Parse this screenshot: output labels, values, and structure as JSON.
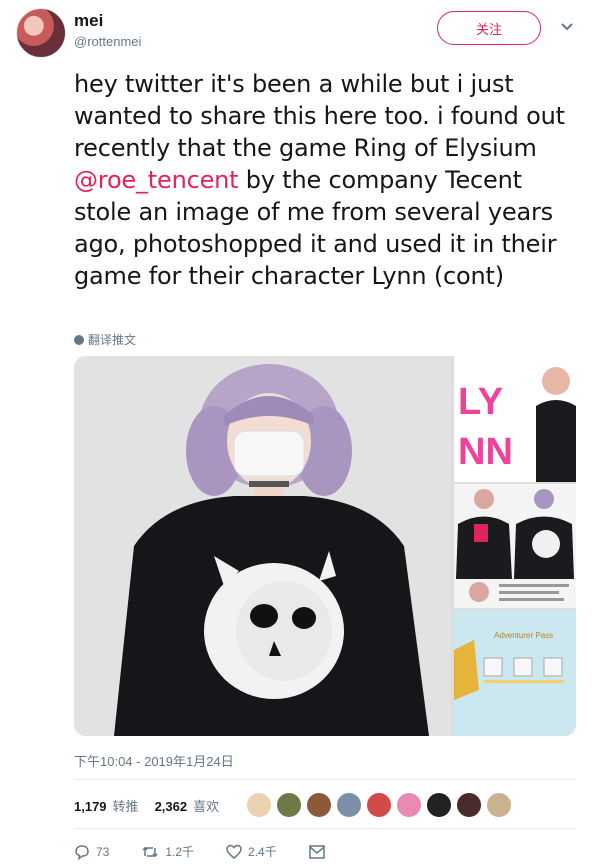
{
  "author": {
    "name": "mei",
    "handle": "@rottenmei"
  },
  "follow_label": "关注",
  "tweet": {
    "text_before": "hey twitter it's been a while but i just wanted to share this here too. i found out recently that the game Ring of Elysium ",
    "mention": "@roe_tencent",
    "text_after": " by the company Tecent stole an image of me from several years ago, photoshopped it and used it in their game for their character Lynn (cont)",
    "translate_label": "翻译推文"
  },
  "media": {
    "side_labels": [
      "LYNN",
      "Adventurer Pass"
    ]
  },
  "timestamp": "下午10:04 - 2019年1月24日",
  "stats": {
    "retweets": "1,179",
    "retweets_label": "转推",
    "likes": "2,362",
    "likes_label": "喜欢"
  },
  "actions": {
    "replies": "73",
    "retweets": "1.2千",
    "likes": "2.4千"
  },
  "colors": {
    "accent": "#e0245e",
    "secondary_text": "#657786"
  }
}
